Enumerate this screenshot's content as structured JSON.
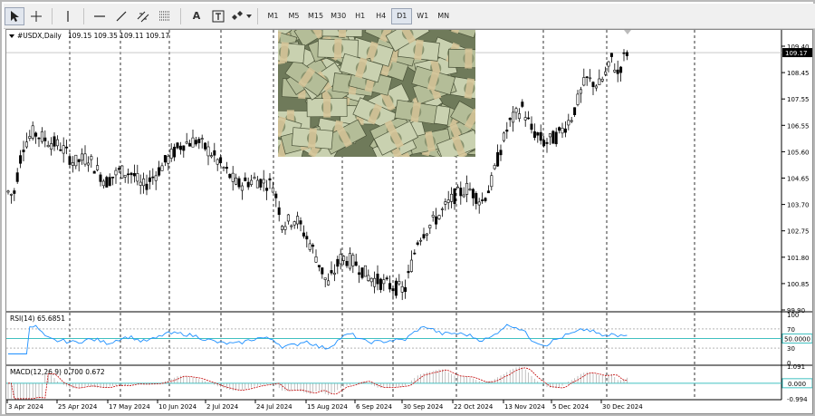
{
  "toolbar": {
    "tools": [
      {
        "name": "cursor-tool",
        "icon": "arrow-cursor-icon",
        "active": true
      },
      {
        "name": "crosshair-tool",
        "icon": "crosshair-icon",
        "active": false
      },
      {
        "name": "vertical-line-tool",
        "icon": "vertical-line-icon",
        "active": false
      },
      {
        "name": "horizontal-line-tool",
        "icon": "horizontal-line-icon",
        "active": false
      },
      {
        "name": "trendline-tool",
        "icon": "trendline-icon",
        "active": false
      },
      {
        "name": "channel-tool",
        "icon": "channel-icon",
        "active": false
      },
      {
        "name": "fibonacci-tool",
        "icon": "fibonacci-icon",
        "active": false
      },
      {
        "name": "text-tool",
        "icon": "text-icon",
        "label": "A",
        "active": false
      },
      {
        "name": "text-label-tool",
        "icon": "text-label-icon",
        "label": "T",
        "active": false
      },
      {
        "name": "shapes-tool",
        "icon": "shapes-icon",
        "active": false
      }
    ],
    "timeframes": [
      "M1",
      "M5",
      "M15",
      "M30",
      "H1",
      "H4",
      "D1",
      "W1",
      "MN"
    ],
    "active_timeframe": "D1"
  },
  "main_chart": {
    "symbol_label": "#USDX,Daily",
    "ohlc_label": "109.15 109.35 109.11 109.17",
    "price_levels": [
      "109.40",
      "108.45",
      "107.55",
      "106.55",
      "105.60",
      "104.65",
      "103.70",
      "102.75",
      "101.80",
      "100.85",
      "99.90"
    ],
    "current_price": "109.17"
  },
  "rsi": {
    "label": "RSI(14) 65.6851",
    "levels": [
      "100",
      "70",
      "50.0000",
      "30",
      "0"
    ],
    "highlight_level": "50.0000",
    "line_color": "#1e90ff"
  },
  "macd": {
    "label": "MACD(12,26,9) 0.700 0.672",
    "levels": [
      "1.091",
      "0.000",
      "-0.994"
    ],
    "highlight_level": "0.000"
  },
  "date_axis": [
    "3 Apr 2024",
    "25 Apr 2024",
    "17 May 2024",
    "10 Jun 2024",
    "2 Jul 2024",
    "24 Jul 2024",
    "15 Aug 2024",
    "6 Sep 2024",
    "30 Sep 2024",
    "22 Oct 2024",
    "13 Nov 2024",
    "5 Dec 2024",
    "30 Dec 2024"
  ],
  "colors": {
    "candle": "#000000",
    "grid": "#000000",
    "highlight_box": "#40c0c0",
    "signal_line": "#c00000"
  }
}
